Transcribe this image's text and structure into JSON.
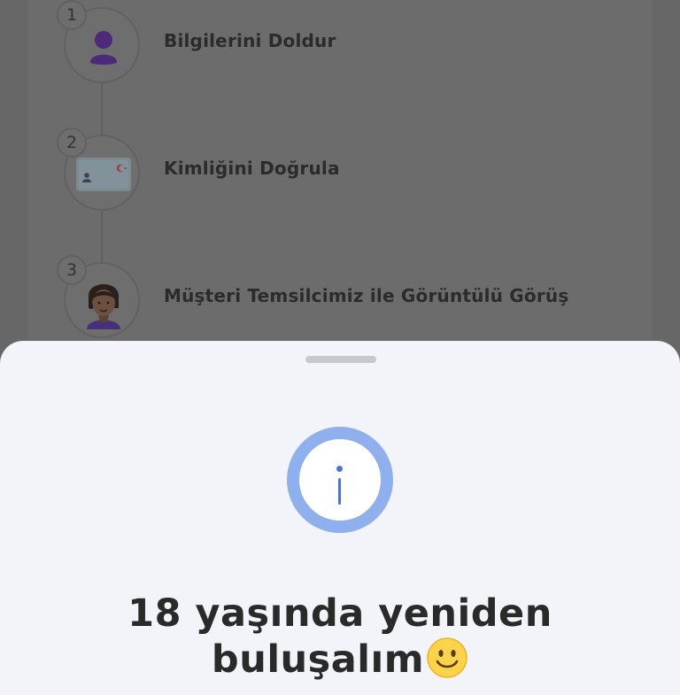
{
  "steps": [
    {
      "number": "1",
      "label": "Bilgilerini Doldur",
      "icon": "person-icon"
    },
    {
      "number": "2",
      "label": "Kimliğini Doğrula",
      "icon": "id-card-icon"
    },
    {
      "number": "3",
      "label": "Müşteri Temsilcimiz ile Görüntülü Görüş",
      "icon": "agent-avatar"
    }
  ],
  "sheet": {
    "icon": "info-icon",
    "title_line1": "18 yaşında yeniden",
    "title_line2": "buluşalım",
    "emoji": "slightly-smiling-face"
  },
  "colors": {
    "overlay_background": "#676767",
    "sheet_background": "#f2f4fa",
    "info_ring": "#8fb0ec",
    "info_glyph": "#4a78c9",
    "person_icon": "#5b2aa0",
    "title_text": "#2a2a2a"
  }
}
